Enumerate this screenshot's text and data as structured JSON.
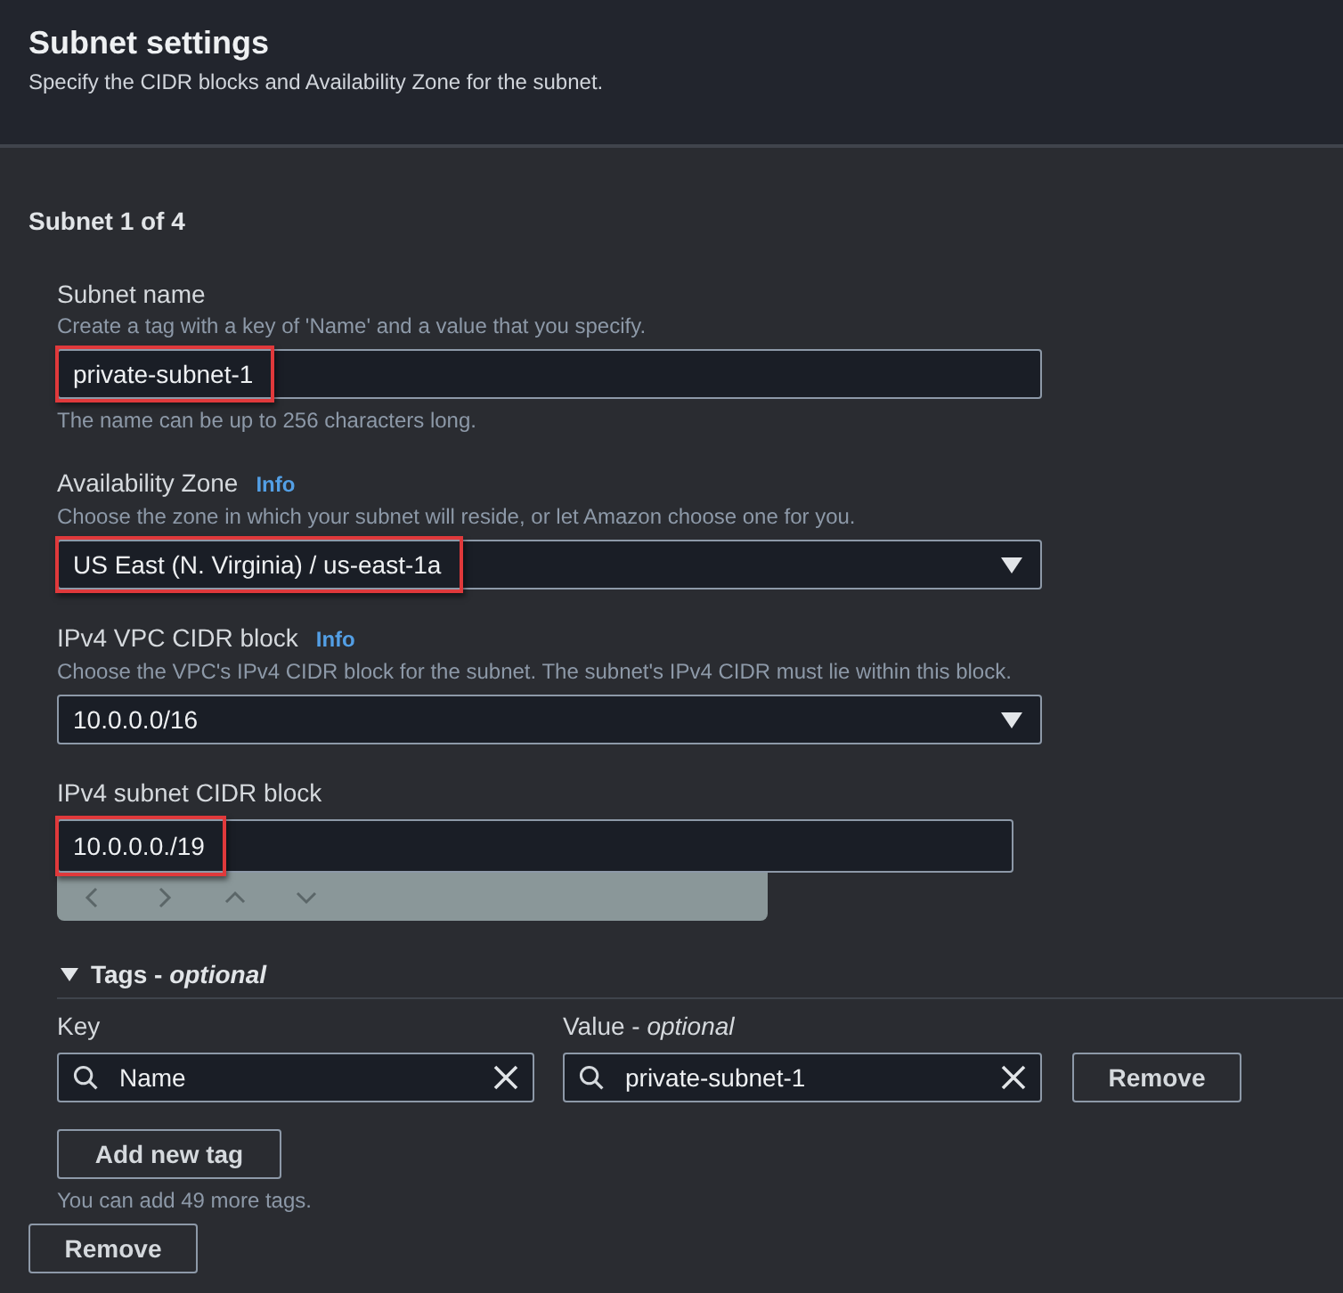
{
  "header": {
    "title": "Subnet settings",
    "description": "Specify the CIDR blocks and Availability Zone for the subnet."
  },
  "subnet": {
    "title": "Subnet 1 of 4",
    "fields": [
      {
        "kind": "text",
        "label": "Subnet name",
        "description": "Create a tag with a key of 'Name' and a value that you specify.",
        "value": "private-subnet-1",
        "highlighted": true,
        "constraint": "The name can be up to 256 characters long."
      },
      {
        "kind": "select",
        "label": "Availability Zone",
        "info": "Info",
        "description": "Choose the zone in which your subnet will reside, or let Amazon choose one for you.",
        "value": "US East (N. Virginia) / us-east-1a",
        "highlighted": true
      },
      {
        "kind": "select",
        "label": "IPv4 VPC CIDR block",
        "info": "Info",
        "description": "Choose the VPC's IPv4 CIDR block for the subnet. The subnet's IPv4 CIDR must lie within this block.",
        "value": "10.0.0.0/16",
        "highlighted": false
      },
      {
        "kind": "cidr",
        "label": "IPv4 subnet CIDR block",
        "value": "10.0.0.0./19",
        "highlighted": true
      }
    ],
    "tags": {
      "title": "Tags - *optional*",
      "expanded": true,
      "key_label": "Key",
      "value_label": "Value - *optional*",
      "rows": [
        {
          "key": "Name",
          "value": "private-subnet-1",
          "remove": "Remove"
        }
      ],
      "add_button": "Add new tag",
      "limit_note": "You can add 49 more tags."
    },
    "remove_button": "Remove"
  }
}
